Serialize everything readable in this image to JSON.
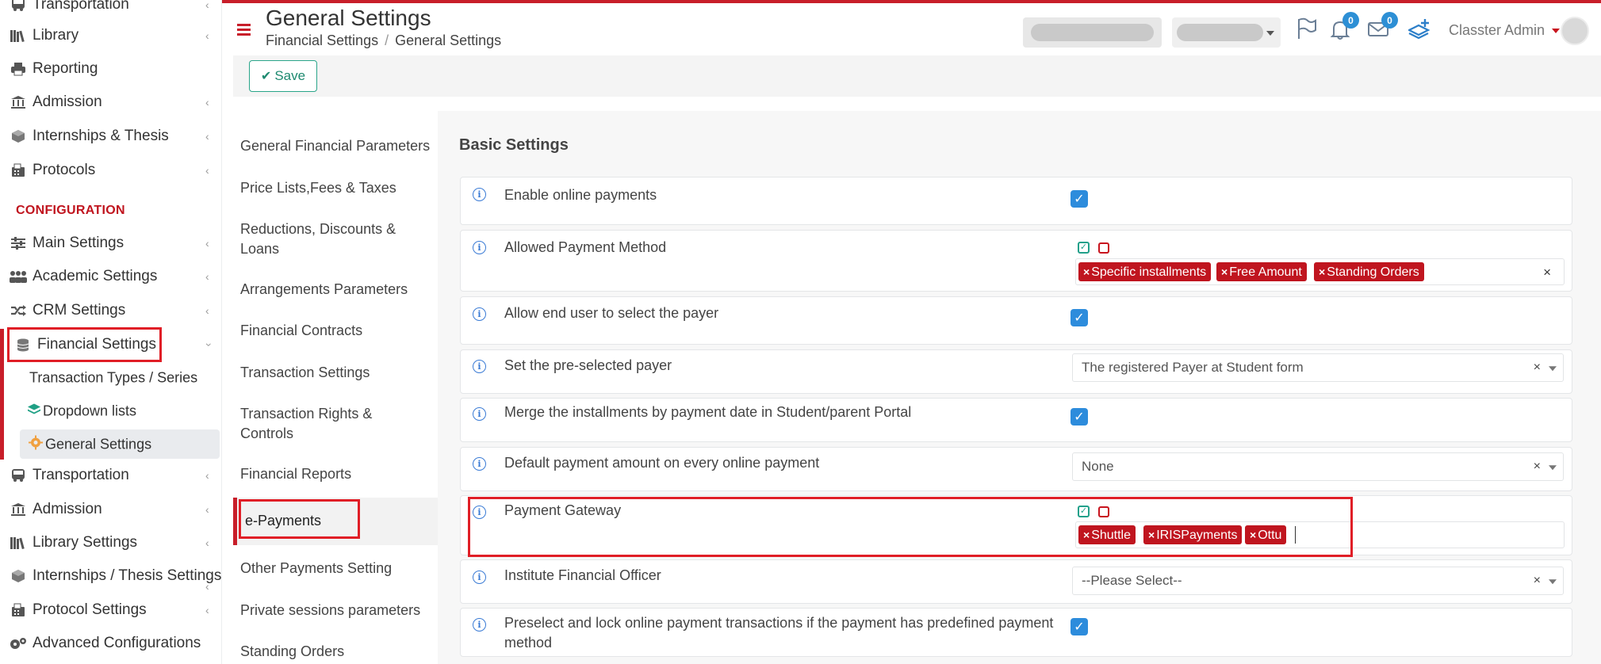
{
  "sidebar": {
    "items_top": [
      {
        "label": "Transportation",
        "icon": "bus-icon"
      },
      {
        "label": "Library",
        "icon": "books-icon"
      },
      {
        "label": "Reporting",
        "icon": "printer-icon"
      },
      {
        "label": "Admission",
        "icon": "institution-icon"
      },
      {
        "label": "Internships & Thesis",
        "icon": "cube-icon"
      },
      {
        "label": "Protocols",
        "icon": "fax-icon"
      }
    ],
    "config_header": "CONFIGURATION",
    "config_items": [
      {
        "label": "Main Settings",
        "icon": "sliders-icon"
      },
      {
        "label": "Academic Settings",
        "icon": "users-icon"
      },
      {
        "label": "CRM Settings",
        "icon": "shuffle-icon"
      },
      {
        "label": "Financial Settings",
        "icon": "coins-icon"
      }
    ],
    "financial_sub": [
      {
        "label": "Transaction Types / Series"
      },
      {
        "label": "Dropdown lists",
        "icon": "layers-icon"
      },
      {
        "label": "General Settings",
        "icon": "gear-icon"
      }
    ],
    "items_bottom": [
      {
        "label": "Transportation",
        "icon": "bus-icon"
      },
      {
        "label": "Admission",
        "icon": "institution-icon"
      },
      {
        "label": "Library Settings",
        "icon": "books-icon"
      },
      {
        "label": "Internships / Thesis Settings",
        "icon": "cube-icon"
      },
      {
        "label": "Protocol Settings",
        "icon": "fax-icon"
      },
      {
        "label": "Advanced Configurations",
        "icon": "gears-icon"
      }
    ]
  },
  "header": {
    "title": "General Settings",
    "breadcrumb": [
      "Financial Settings",
      "General Settings"
    ],
    "notifications_count": "0",
    "messages_count": "0",
    "user_name": "Classter Admin"
  },
  "toolbar": {
    "save_label": "Save"
  },
  "settings_nav": [
    "General Financial Parameters",
    "Price Lists,Fees & Taxes",
    "Reductions, Discounts & Loans",
    "Arrangements Parameters",
    "Financial Contracts",
    "Transaction Settings",
    "Transaction Rights & Controls",
    "Financial Reports",
    "e-Payments",
    "Other Payments Setting",
    "Private sessions parameters",
    "Standing Orders"
  ],
  "main": {
    "section_title": "Basic Settings",
    "rows": {
      "enable_online": "Enable online payments",
      "allowed_method": "Allowed Payment Method",
      "allowed_method_tags": [
        "Specific installments",
        "Free Amount",
        "Standing Orders"
      ],
      "allow_select_payer": "Allow end user to select the payer",
      "preselected_payer": "Set the pre-selected payer",
      "preselected_payer_value": "The registered Payer at Student form",
      "merge_installments": "Merge the installments by payment date in Student/parent Portal",
      "default_amount": "Default payment amount on every online payment",
      "default_amount_value": "None",
      "gateway": "Payment Gateway",
      "gateway_tags": [
        "Shuttle",
        "IRISPayments",
        "Ottu"
      ],
      "officer": "Institute Financial Officer",
      "officer_value": "--Please Select--",
      "preselect_lock": "Preselect and lock online payment transactions if the payment has predefined payment method"
    }
  },
  "colors": {
    "accent_red": "#c81e2a",
    "checkbox_blue": "#2d8cdc",
    "highlight_box": "#e01e26"
  }
}
